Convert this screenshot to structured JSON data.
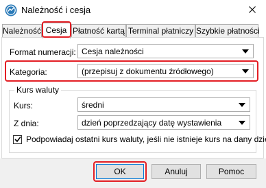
{
  "window": {
    "title": "Należność i cesja",
    "icon": "app-logo-icon"
  },
  "tabs": [
    {
      "label": "Należność",
      "active": false
    },
    {
      "label": "Cesja",
      "active": true
    },
    {
      "label": "Płatność kartą",
      "active": false
    },
    {
      "label": "Terminal płatniczy",
      "active": false
    },
    {
      "label": "Szybkie płatności",
      "active": false
    }
  ],
  "form": {
    "format_label": "Format numeracji:",
    "format_value": "Cesja należności",
    "category_label": "Kategoria:",
    "category_value": "(przepisuj z dokumentu źródłowego)"
  },
  "exchange": {
    "group_title": "Kurs waluty",
    "rate_label": "Kurs:",
    "rate_value": "średni",
    "day_label": "Z dnia:",
    "day_value": "dzień poprzedzający datę wystawienia",
    "suggest_label": "Podpowiadaj ostatni kurs waluty, jeśli nie istnieje kurs na dany dzień",
    "suggest_checked": true
  },
  "buttons": {
    "ok": "OK",
    "cancel": "Anuluj",
    "help": "Pomoc"
  },
  "colors": {
    "highlight": "#e31e24",
    "app_icon": "#2a7ab8",
    "footer": "#f0f0f0"
  }
}
